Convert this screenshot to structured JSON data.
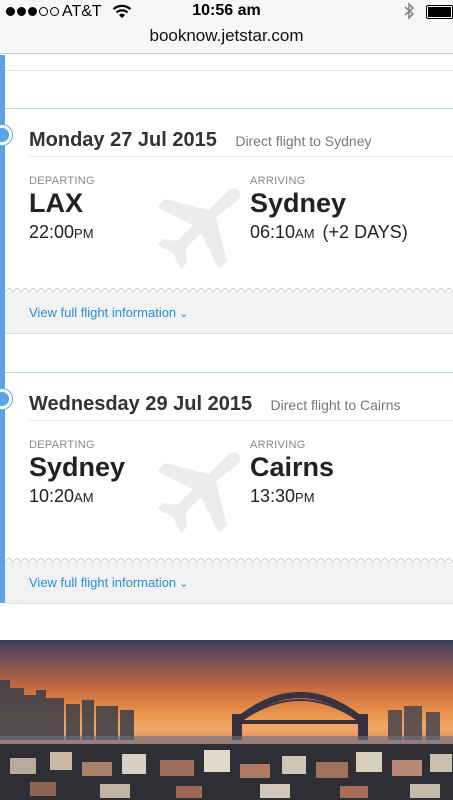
{
  "status_bar": {
    "carrier": "AT&T",
    "time": "10:56 am"
  },
  "browser": {
    "url": "booknow.jetstar.com"
  },
  "flights": [
    {
      "date": "Monday 27 Jul 2015",
      "route_type": "Direct flight to Sydney",
      "departing_label": "DEPARTING",
      "departing_city": "LAX",
      "departing_time": "22:00",
      "departing_ampm": "PM",
      "arriving_label": "ARRIVING",
      "arriving_city": "Sydney",
      "arriving_time": "06:10",
      "arriving_ampm": "AM",
      "arriving_extra": "(+2 DAYS)",
      "view_link": "View full flight information"
    },
    {
      "date": "Wednesday 29 Jul 2015",
      "route_type": "Direct flight to Cairns",
      "departing_label": "DEPARTING",
      "departing_city": "Sydney",
      "departing_time": "10:20",
      "departing_ampm": "AM",
      "arriving_label": "ARRIVING",
      "arriving_city": "Cairns",
      "arriving_time": "13:30",
      "arriving_ampm": "PM",
      "arriving_extra": "",
      "view_link": "View full flight information"
    }
  ],
  "colors": {
    "accent": "#5aa3e6",
    "link": "#2a8fd6"
  }
}
